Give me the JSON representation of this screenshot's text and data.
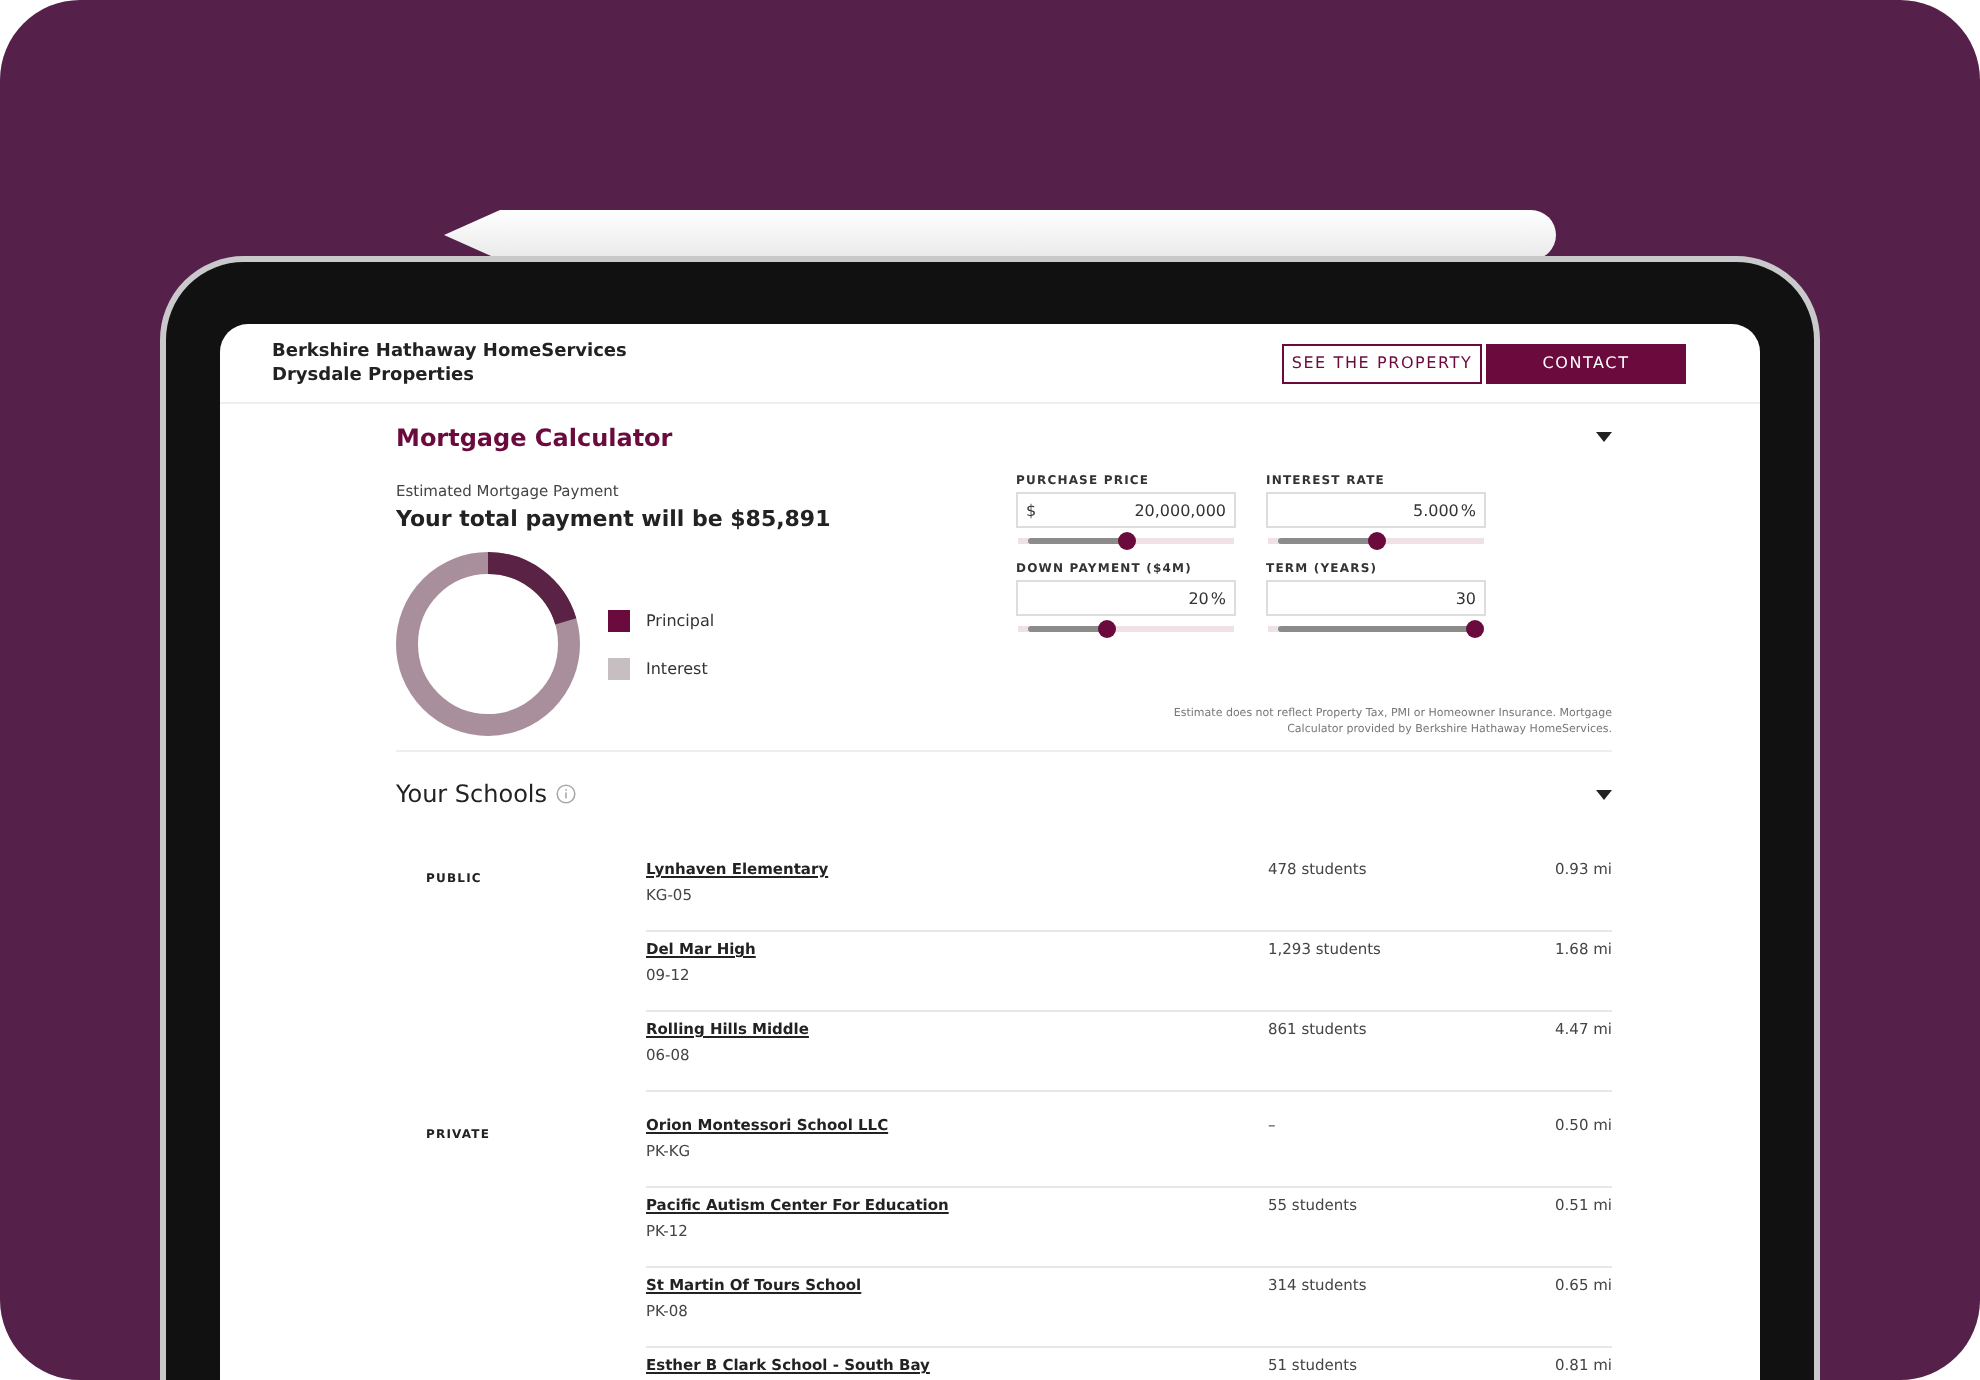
{
  "header": {
    "brand_lines": [
      "Berkshire Hathaway HomeServices",
      "Drysdale Properties"
    ],
    "buttons": [
      {
        "label": "SEE THE PROPERTY",
        "kind": "outline"
      },
      {
        "label": "CONTACT",
        "kind": "solid"
      }
    ]
  },
  "mortgage": {
    "title": "Mortgage Calculator",
    "payment_label": "Estimated Mortgage Payment",
    "payment_total": "Your total payment will be $85,891",
    "legend": [
      {
        "label": "Principal",
        "color": "#6b0a3d"
      },
      {
        "label": "Interest",
        "color": "#c6bec1"
      }
    ],
    "fields": [
      {
        "label": "PURCHASE PRICE",
        "prefix": "$",
        "value": "20,000,000",
        "level": 0.5
      },
      {
        "label": "INTEREST RATE",
        "value": "5.000",
        "suffix": "%",
        "level": 0.5
      },
      {
        "label": "DOWN PAYMENT ($4M)",
        "value": "20",
        "suffix": "%",
        "level": 0.4
      },
      {
        "label": "TERM (YEARS)",
        "value": "30",
        "level": 1
      }
    ],
    "disclaimer": "Estimate does not reflect Property Tax, PMI or Homeowner Insurance. Mortgage Calculator provided by Berkshire Hathaway HomeServices."
  },
  "schools": {
    "title": "Your Schools",
    "groups": [
      {
        "category": "PUBLIC",
        "schools": [
          {
            "name": "Lynhaven Elementary",
            "grades": "KG-05",
            "students": "478 students",
            "distance": "0.93 mi"
          },
          {
            "name": "Del Mar High",
            "grades": "09-12",
            "students": "1,293 students",
            "distance": "1.68 mi"
          },
          {
            "name": "Rolling Hills Middle",
            "grades": "06-08",
            "students": "861 students",
            "distance": "4.47 mi"
          }
        ]
      },
      {
        "category": "PRIVATE",
        "schools": [
          {
            "name": "Orion Montessori School LLC",
            "grades": "PK-KG",
            "students": "–",
            "distance": "0.50 mi"
          },
          {
            "name": "Pacific Autism Center For Education",
            "grades": "PK-12",
            "students": "55 students",
            "distance": "0.51 mi"
          },
          {
            "name": "St Martin Of Tours School",
            "grades": "PK-08",
            "students": "314 students",
            "distance": "0.65 mi"
          },
          {
            "name": "Esther B Clark School - South Bay",
            "students": "51 students",
            "distance": "0.81 mi"
          }
        ]
      }
    ]
  }
}
